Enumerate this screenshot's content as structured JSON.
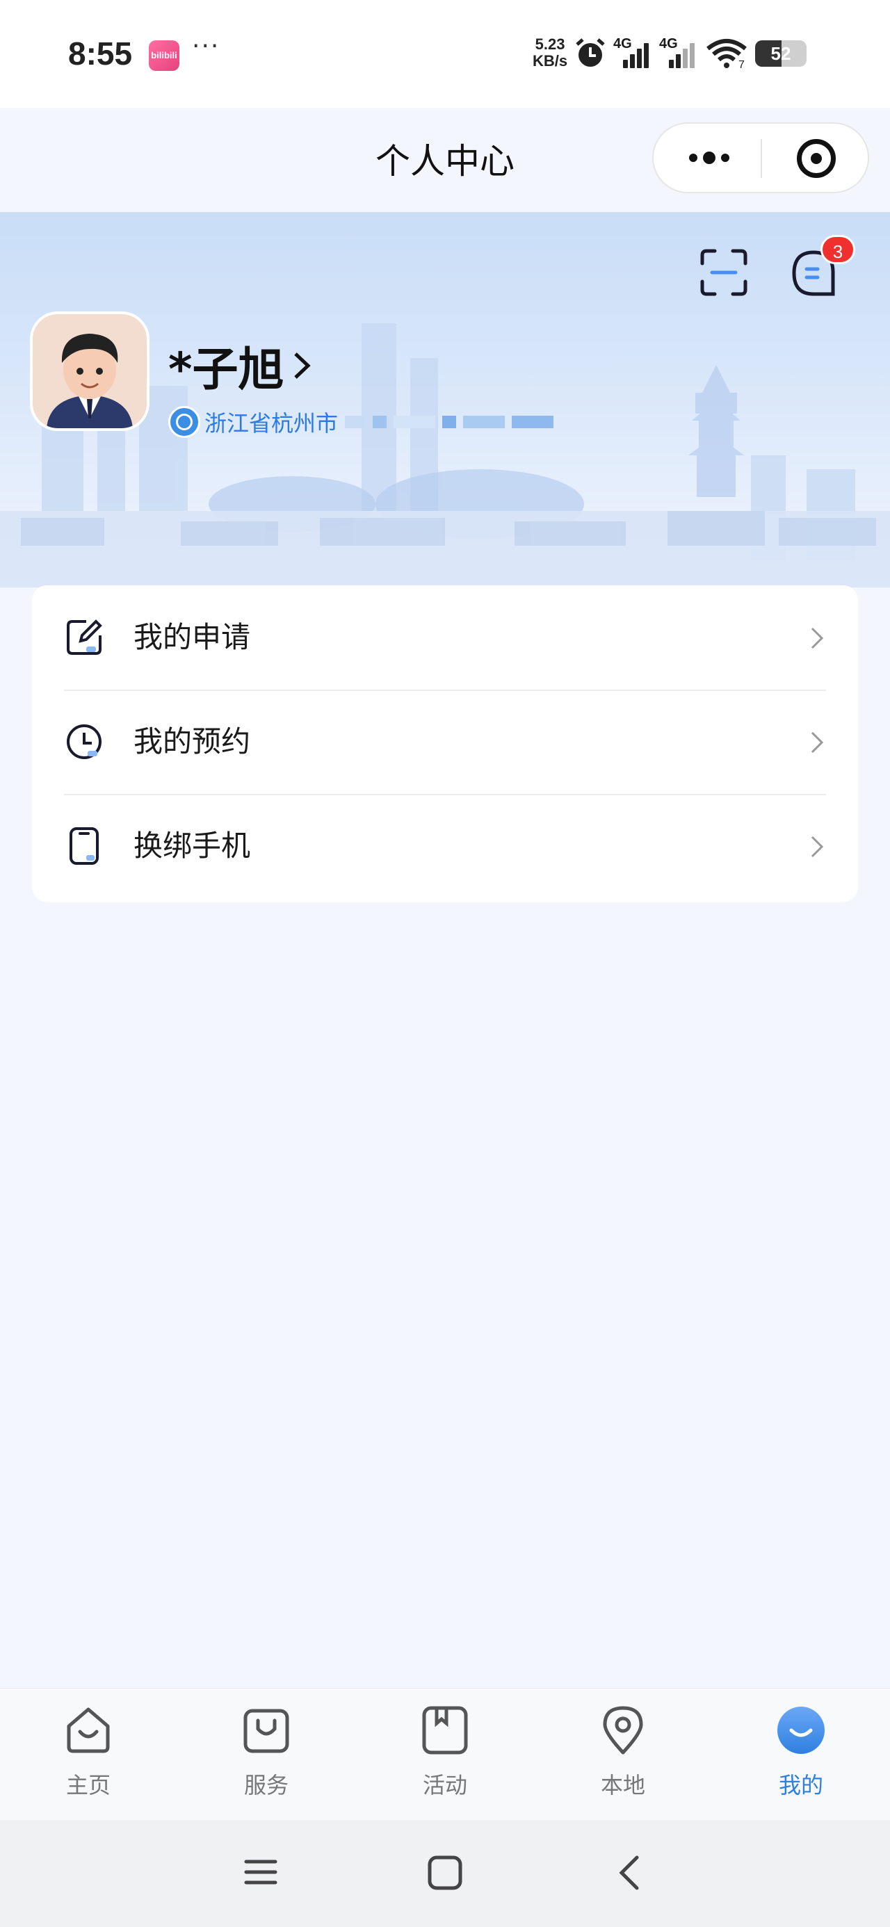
{
  "status_bar": {
    "time": "8:55",
    "app_icon_text": "bilibili",
    "more": "···",
    "speed_value": "5.23",
    "speed_unit": "KB/s",
    "sim1": "4G",
    "sim2": "4G",
    "wifi_label": "7",
    "battery": "52",
    "battery_level": 0.52
  },
  "nav": {
    "title": "个人中心"
  },
  "header": {
    "username": "*子旭",
    "region": "浙江省杭州市",
    "message_badge": "3"
  },
  "menu": [
    {
      "label": "我的申请",
      "icon": "edit-icon"
    },
    {
      "label": "我的预约",
      "icon": "clock-icon"
    },
    {
      "label": "换绑手机",
      "icon": "phone-icon"
    }
  ],
  "tabbar": {
    "items": [
      {
        "label": "主页",
        "icon": "home-bag-icon"
      },
      {
        "label": "服务",
        "icon": "shopping-bag-icon"
      },
      {
        "label": "活动",
        "icon": "bookmark-book-icon"
      },
      {
        "label": "本地",
        "icon": "location-pin-icon"
      },
      {
        "label": "我的",
        "icon": "profile-smile-icon"
      }
    ],
    "active_color": "#2f7fe0"
  },
  "colors": {
    "accent": "#2f7fe0",
    "badge": "#f0302f",
    "background": "#f3f6fc"
  }
}
